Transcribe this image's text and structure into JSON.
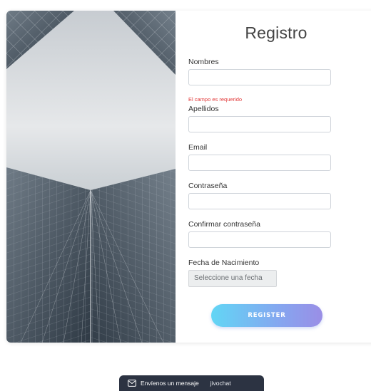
{
  "form": {
    "title": "Registro",
    "fields": {
      "nombres": {
        "label": "Nombres",
        "value": "",
        "error": "El campo es requerido"
      },
      "apellidos": {
        "label": "Apellidos",
        "value": ""
      },
      "email": {
        "label": "Email",
        "value": ""
      },
      "contrasena": {
        "label": "Contraseña",
        "value": ""
      },
      "confirmar": {
        "label": "Confirmar contraseña",
        "value": ""
      },
      "fecha": {
        "label": "Fecha de Nacimiento",
        "placeholder": "Seleccione una fecha"
      }
    },
    "register_label": "REGISTER"
  },
  "chat": {
    "message_label": "Envíenos un mensaje",
    "brand": "jivochat"
  },
  "hero": {
    "icon": "glass-skyscraper-image"
  }
}
